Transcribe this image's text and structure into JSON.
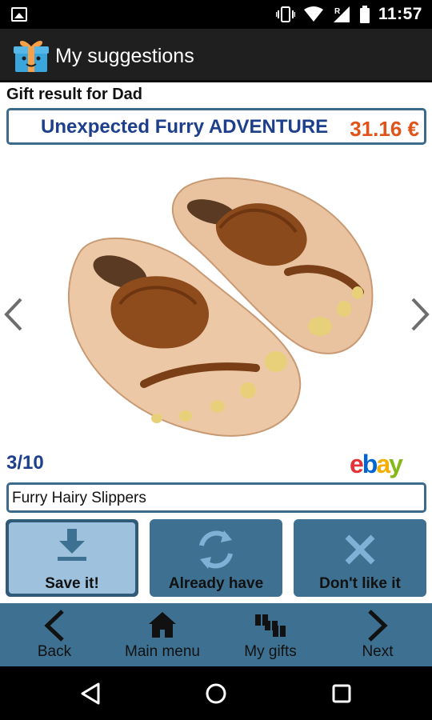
{
  "status_bar": {
    "time": "11:57",
    "roaming_label": "R",
    "icons": [
      "image-notification-icon",
      "vibrate-icon",
      "wifi-icon",
      "signal-icon",
      "battery-icon"
    ]
  },
  "action_bar": {
    "title": "My suggestions",
    "icon": "gift-box-icon"
  },
  "content": {
    "gift_result_label": "Gift result for Dad",
    "product_name": "Unexpected Furry ADVENTURE",
    "price": "31.16 €",
    "counter": "3/10",
    "store_logo_text": "ebay",
    "item_title": "Furry Hairy Slippers"
  },
  "actions": {
    "save_label": "Save it!",
    "already_have_label": "Already have",
    "dislike_label": "Don't like it"
  },
  "bottom_nav": {
    "back_label": "Back",
    "main_menu_label": "Main menu",
    "my_gifts_label": "My gifts",
    "next_label": "Next"
  },
  "colors": {
    "accent_blue": "#3e7191",
    "title_blue": "#1d3f8c",
    "price_orange": "#e0541a",
    "selected_button": "#9ec2dd"
  }
}
